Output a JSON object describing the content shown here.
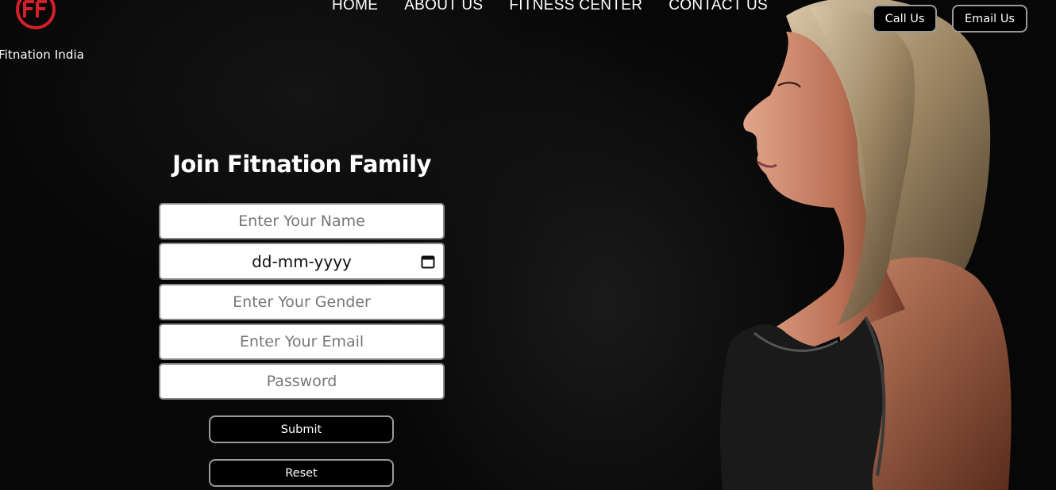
{
  "brand": {
    "name": "Fitnation India",
    "logo_icon": "ff-logo-icon",
    "accent": "#d31f2a"
  },
  "nav": {
    "items": [
      "HOME",
      "ABOUT US",
      "FITNESS CENTER",
      "CONTACT US"
    ]
  },
  "header_buttons": {
    "call_label": "Call Us",
    "email_label": "Email Us"
  },
  "form": {
    "title": "Join Fitnation Family",
    "name_placeholder": "Enter Your Name",
    "date_value": "dd-mm-yyyy",
    "gender_placeholder": "Enter Your Gender",
    "email_placeholder": "Enter Your Email",
    "password_placeholder": "Password",
    "submit_label": "Submit",
    "reset_label": "Reset"
  }
}
